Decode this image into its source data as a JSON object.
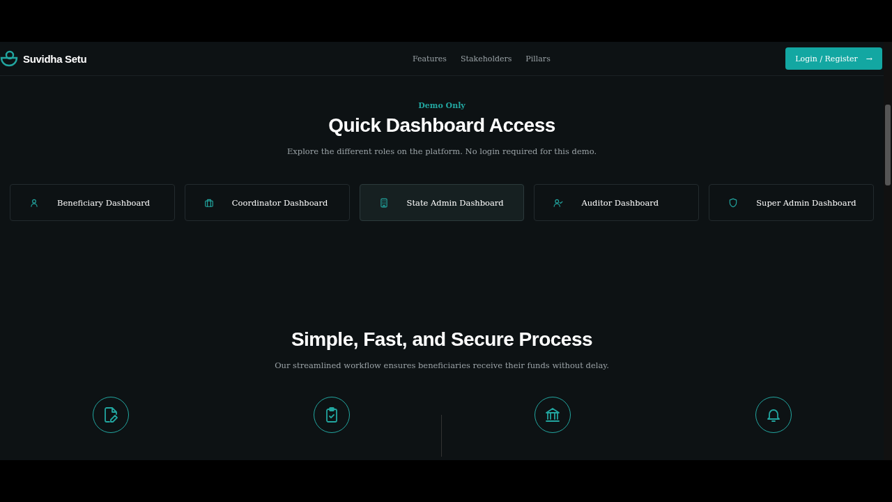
{
  "brand": "Suvidha Setu",
  "nav": [
    "Features",
    "Stakeholders",
    "Pillars"
  ],
  "login_button": {
    "label": "Login / Register",
    "icon": "→"
  },
  "demo": {
    "eyebrow": "Demo Only",
    "title": "Quick Dashboard Access",
    "subtitle": "Explore the different roles on the platform. No login required for this demo.",
    "cards": [
      {
        "label": "Beneficiary Dashboard",
        "kind": "user",
        "highlighted": false
      },
      {
        "label": "Coordinator Dashboard",
        "kind": "briefcase",
        "highlighted": false
      },
      {
        "label": "State Admin Dashboard",
        "kind": "building",
        "highlighted": true
      },
      {
        "label": "Auditor Dashboard",
        "kind": "user-check",
        "highlighted": false
      },
      {
        "label": "Super Admin Dashboard",
        "kind": "shield",
        "highlighted": false
      }
    ]
  },
  "process": {
    "title": "Simple, Fast, and Secure Process",
    "subtitle": "Our streamlined workflow ensures beneficiaries receive their funds without delay.",
    "steps": [
      {
        "kind": "file-pen"
      },
      {
        "kind": "clipboard-check"
      },
      {
        "kind": "bank"
      },
      {
        "kind": "bell"
      }
    ]
  }
}
